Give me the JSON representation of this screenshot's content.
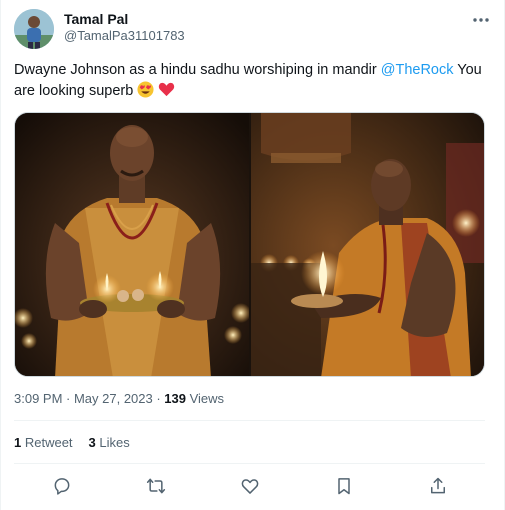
{
  "author": {
    "name": "Tamal Pal",
    "handle": "@TamalPa31101783"
  },
  "tweet": {
    "text_before": "Dwayne Johnson as a hindu sadhu worshiping in mandir ",
    "mention": "@TheRock",
    "text_after": " You are looking superb"
  },
  "meta": {
    "timestamp": "3:09 PM · May 27, 2023 · ",
    "views_count": "139",
    "views_label": " Views"
  },
  "stats": {
    "retweets_count": "1",
    "retweets_label": " Retweet",
    "likes_count": "3",
    "likes_label": " Likes"
  },
  "icons": {
    "more": "more-horizontal-icon",
    "reply": "reply-icon",
    "retweet": "retweet-icon",
    "like": "heart-icon",
    "bookmark": "bookmark-icon",
    "share": "share-icon"
  },
  "colors": {
    "accent": "#1d9bf0",
    "text": "#0f1419",
    "muted": "#536471",
    "heart_emoji": "#e8304a",
    "smile_emoji": "#f7c430"
  }
}
